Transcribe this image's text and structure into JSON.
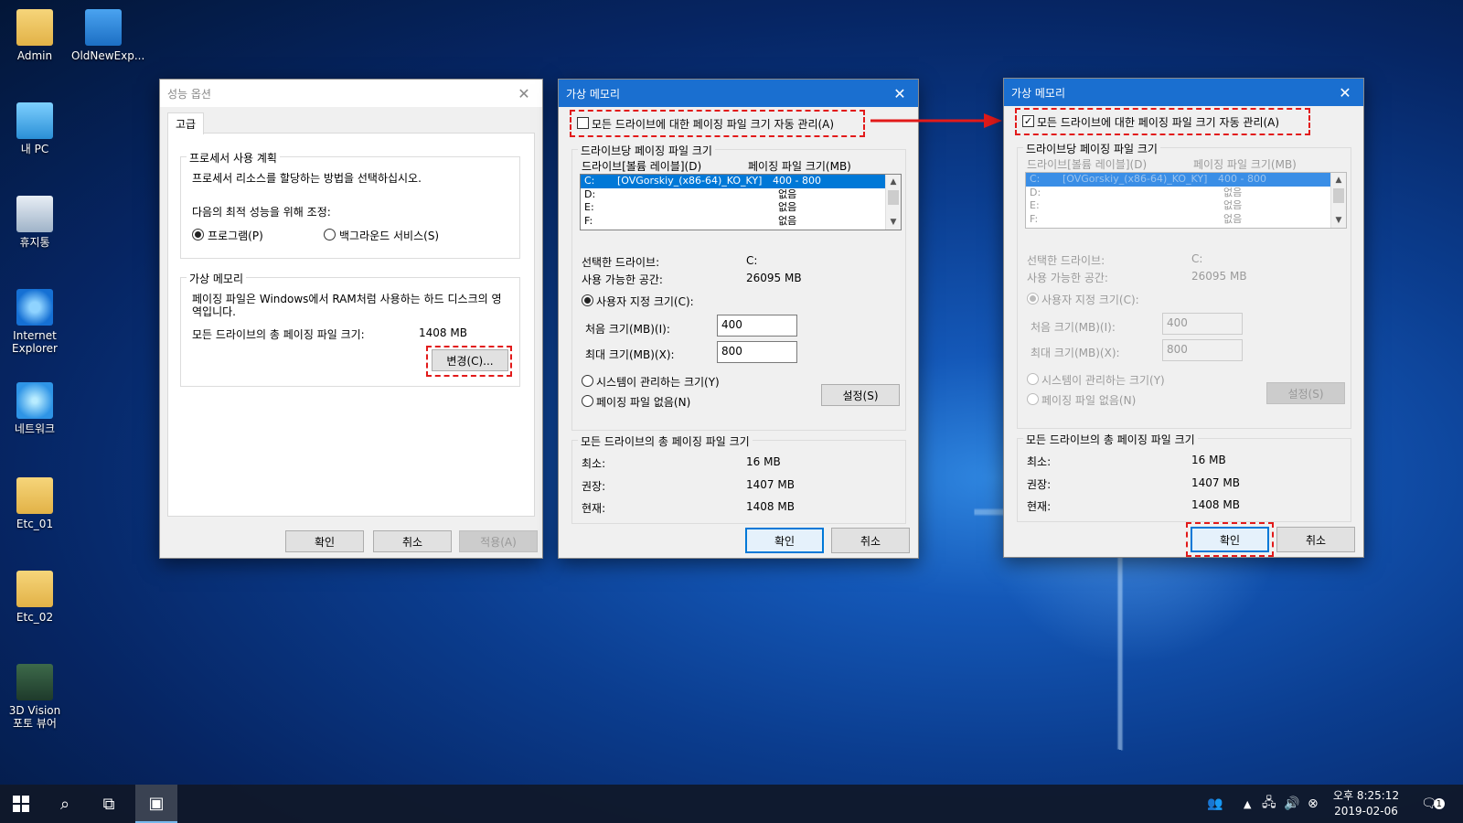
{
  "desktop": {
    "icons": [
      {
        "label": "Admin",
        "icon": "user-folder-icon"
      },
      {
        "label": "OldNewExp...",
        "icon": "shield-shortcut-icon"
      },
      {
        "label": "내 PC",
        "icon": "computer-icon"
      },
      {
        "label": "휴지통",
        "icon": "recycle-bin-icon"
      },
      {
        "label": "Internet Explorer",
        "icon": "internet-explorer-icon"
      },
      {
        "label": "네트워크",
        "icon": "network-icon"
      },
      {
        "label": "Etc_01",
        "icon": "folder-icon"
      },
      {
        "label": "Etc_02",
        "icon": "folder-icon"
      },
      {
        "label": "3D Vision 포토 뷰어",
        "icon": "photo-viewer-icon"
      }
    ]
  },
  "perf": {
    "title": "성능 옵션",
    "tab": "고급",
    "cpu": {
      "legend": "프로세서 사용 계획",
      "desc": "프로세서 리소스를 할당하는 방법을 선택하십시오.",
      "adjust": "다음의 최적 성능을 위해 조정:",
      "opt_program": "프로그램(P)",
      "opt_background": "백그라운드 서비스(S)",
      "selected": "program"
    },
    "vm": {
      "legend": "가상 메모리",
      "desc": "페이징 파일은 Windows에서 RAM처럼 사용하는 하드 디스크의 영역입니다.",
      "total_label": "모든 드라이브의 총 페이징 파일 크기:",
      "total_value": "1408 MB",
      "change_btn": "변경(C)..."
    },
    "buttons": {
      "ok": "확인",
      "cancel": "취소",
      "apply": "적용(A)"
    }
  },
  "vm_before": {
    "title": "가상 메모리",
    "auto_label": "모든 드라이브에 대한 페이징 파일 크기 자동 관리(A)",
    "auto_checked": false,
    "per_drive_legend": "드라이브당 페이징 파일 크기",
    "col_drive": "드라이브[볼륨 레이블](D)",
    "col_size": "페이징 파일 크기(MB)",
    "drives": [
      {
        "drive": "C:",
        "label": "[OVGorskiy_(x86-64)_KO_KY]",
        "size": "400 - 800"
      },
      {
        "drive": "D:",
        "label": "",
        "size": "없음"
      },
      {
        "drive": "E:",
        "label": "",
        "size": "없음"
      },
      {
        "drive": "F:",
        "label": "",
        "size": "없음"
      }
    ],
    "sel_drive_label": "선택한 드라이브:",
    "sel_drive_value": "C:",
    "free_label": "사용 가능한 공간:",
    "free_value": "26095 MB",
    "custom_label": "사용자 지정 크기(C):",
    "initial_label": "처음 크기(MB)(I):",
    "initial_value": "400",
    "max_label": "최대 크기(MB)(X):",
    "max_value": "800",
    "system_label": "시스템이 관리하는 크기(Y)",
    "none_label": "페이징 파일 없음(N)",
    "set_btn": "설정(S)",
    "total_legend": "모든 드라이브의 총 페이징 파일 크기",
    "min_label": "최소:",
    "min_value": "16 MB",
    "rec_label": "권장:",
    "rec_value": "1407 MB",
    "cur_label": "현재:",
    "cur_value": "1408 MB",
    "ok": "확인",
    "cancel": "취소"
  },
  "vm_after": {
    "title": "가상 메모리",
    "auto_label": "모든 드라이브에 대한 페이징 파일 크기 자동 관리(A)",
    "auto_checked": true,
    "per_drive_legend": "드라이브당 페이징 파일 크기",
    "col_drive": "드라이브[볼륨 레이블](D)",
    "col_size": "페이징 파일 크기(MB)",
    "drives": [
      {
        "drive": "C:",
        "label": "[OVGorskiy_(x86-64)_KO_KY]",
        "size": "400 - 800"
      },
      {
        "drive": "D:",
        "label": "",
        "size": "없음"
      },
      {
        "drive": "E:",
        "label": "",
        "size": "없음"
      },
      {
        "drive": "F:",
        "label": "",
        "size": "없음"
      }
    ],
    "sel_drive_label": "선택한 드라이브:",
    "sel_drive_value": "C:",
    "free_label": "사용 가능한 공간:",
    "free_value": "26095 MB",
    "custom_label": "사용자 지정 크기(C):",
    "initial_label": "처음 크기(MB)(I):",
    "initial_value": "400",
    "max_label": "최대 크기(MB)(X):",
    "max_value": "800",
    "system_label": "시스템이 관리하는 크기(Y)",
    "none_label": "페이징 파일 없음(N)",
    "set_btn": "설정(S)",
    "total_legend": "모든 드라이브의 총 페이징 파일 크기",
    "min_label": "최소:",
    "min_value": "16 MB",
    "rec_label": "권장:",
    "rec_value": "1407 MB",
    "cur_label": "현재:",
    "cur_value": "1408 MB",
    "ok": "확인",
    "cancel": "취소"
  },
  "taskbar": {
    "time": "오후 8:25:12",
    "date": "2019-02-06",
    "notification_count": "1"
  },
  "colors": {
    "accent": "#1a6fd0",
    "highlight": "#e21a1a"
  }
}
